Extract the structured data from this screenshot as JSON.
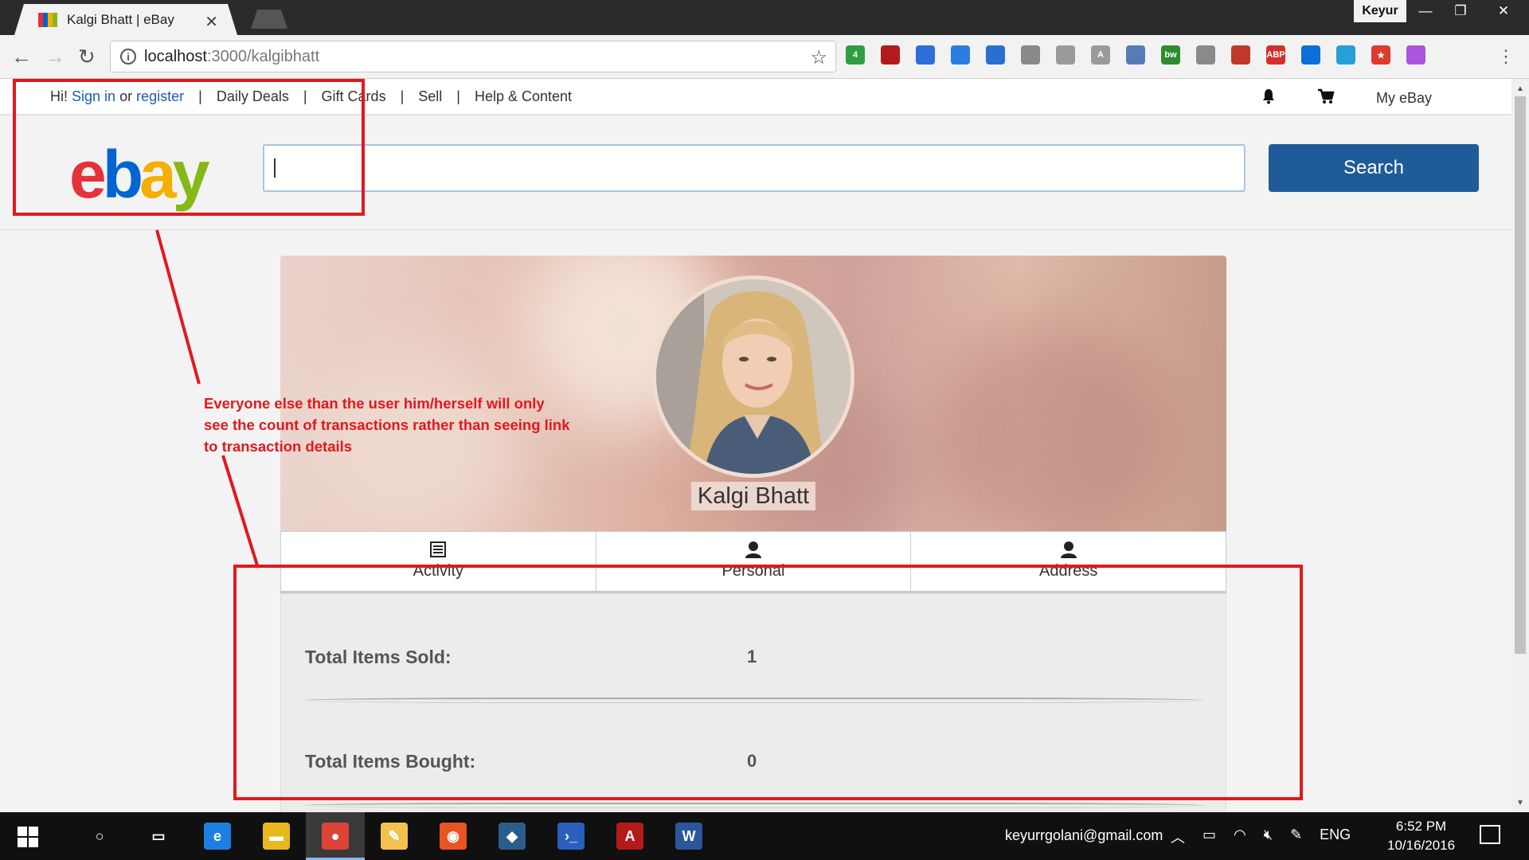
{
  "browser": {
    "tab_title": "Kalgi Bhatt | eBay",
    "tab_close": "✕",
    "profile_name": "Keyur",
    "window_buttons": [
      "—",
      "❐",
      "✕"
    ],
    "url_host": "localhost",
    "url_path": ":3000/kalgibhatt",
    "extensions": [
      {
        "name": "instapaper-ext",
        "label": "4",
        "color": "#2f9e44"
      },
      {
        "name": "acrobat-ext",
        "label": "",
        "color": "#b31b1b"
      },
      {
        "name": "layers-ext",
        "label": "",
        "color": "#2d6fd6"
      },
      {
        "name": "gem-ext",
        "label": "",
        "color": "#2a7de1"
      },
      {
        "name": "megaphone-ext",
        "label": "",
        "color": "#2a6fd0"
      },
      {
        "name": "pen-ext",
        "label": "",
        "color": "#888888"
      },
      {
        "name": "angular-ext",
        "label": "",
        "color": "#9a9a9a"
      },
      {
        "name": "a-ext",
        "label": "A",
        "color": "#9a9a9a"
      },
      {
        "name": "window-ext",
        "label": "",
        "color": "#5a7ab5"
      },
      {
        "name": "bw-ext",
        "label": "bw",
        "color": "#2e8b2e"
      },
      {
        "name": "shield-ext",
        "label": "",
        "color": "#8a8a8a"
      },
      {
        "name": "book-ext",
        "label": "",
        "color": "#c0392b"
      },
      {
        "name": "adblock-ext",
        "label": "ABP",
        "color": "#d0312d"
      },
      {
        "name": "trello-ext",
        "label": "",
        "color": "#0b6fd6"
      },
      {
        "name": "toggle-ext",
        "label": "",
        "color": "#27a0d8"
      },
      {
        "name": "star-box-ext",
        "label": "★",
        "color": "#e03a2f"
      },
      {
        "name": "colorwheel-ext",
        "label": "",
        "color": "#aa55dd"
      }
    ]
  },
  "site": {
    "nav": {
      "greeting": "Hi!",
      "sign_in": "Sign in",
      "or": "or",
      "register": "register",
      "links": [
        "Daily Deals",
        "Gift Cards",
        "Sell",
        "Help & Content"
      ],
      "my_ebay": "My eBay"
    },
    "logo": {
      "letters": [
        "e",
        "b",
        "a",
        "y"
      ],
      "colors": [
        "#e53238",
        "#0064d2",
        "#f5af02",
        "#86b817"
      ]
    },
    "search": {
      "button": "Search",
      "value": ""
    },
    "profile": {
      "name": "Kalgi Bhatt",
      "tabs": [
        {
          "label": "Activity",
          "icon": "list-icon"
        },
        {
          "label": "Personal",
          "icon": "user-icon"
        },
        {
          "label": "Address",
          "icon": "user-icon"
        }
      ],
      "stats": [
        {
          "label": "Total Items Sold:",
          "value": "1"
        },
        {
          "label": "Total Items Bought:",
          "value": "0"
        }
      ]
    }
  },
  "annotation": {
    "text": "Everyone else than the user him/herself will only see the count of transactions rather than seeing link to transaction details",
    "color": "#e0191e"
  },
  "taskbar": {
    "email": "keyurrgolani@gmail.com",
    "language": "ENG",
    "time": "6:52 PM",
    "date": "10/16/2016",
    "apps": [
      {
        "name": "cortana",
        "glyph": "○",
        "color": "transparent"
      },
      {
        "name": "task-view",
        "glyph": "▭",
        "color": "transparent"
      },
      {
        "name": "edge",
        "glyph": "e",
        "color": "#1f7fe0"
      },
      {
        "name": "file-explorer",
        "glyph": "▬",
        "color": "#e8b81f"
      },
      {
        "name": "chrome",
        "glyph": "●",
        "color": "#db4437"
      },
      {
        "name": "paint",
        "glyph": "✎",
        "color": "#f2c14e"
      },
      {
        "name": "ubuntu",
        "glyph": "◉",
        "color": "#e95420"
      },
      {
        "name": "mysql-workbench",
        "glyph": "◆",
        "color": "#2c5d8a"
      },
      {
        "name": "powershell",
        "glyph": "›_",
        "color": "#2a5fbf"
      },
      {
        "name": "acrobat",
        "glyph": "A",
        "color": "#b31b1b"
      },
      {
        "name": "word",
        "glyph": "W",
        "color": "#2b579a"
      }
    ]
  }
}
